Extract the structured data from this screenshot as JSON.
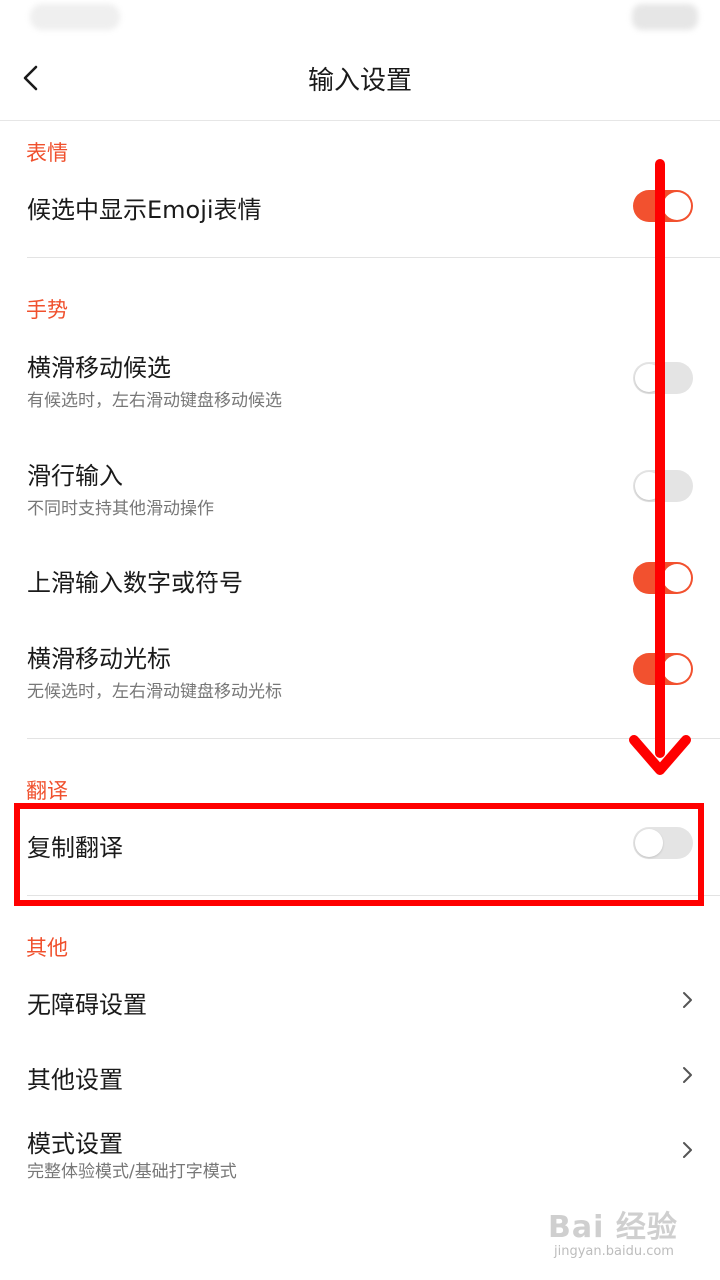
{
  "header": {
    "title": "输入设置",
    "back_icon": "chevron-left-icon"
  },
  "sections": {
    "emoji": {
      "title": "表情",
      "items": [
        {
          "title": "候选中显示Emoji表情",
          "toggle": "on"
        }
      ]
    },
    "gesture": {
      "title": "手势",
      "items": [
        {
          "title": "横滑移动候选",
          "subtitle": "有候选时，左右滑动键盘移动候选",
          "toggle": "off"
        },
        {
          "title": "滑行输入",
          "subtitle": "不同时支持其他滑动操作",
          "toggle": "off"
        },
        {
          "title": "上滑输入数字或符号",
          "toggle": "on"
        },
        {
          "title": "横滑移动光标",
          "subtitle": "无候选时，左右滑动键盘移动光标",
          "toggle": "on"
        }
      ]
    },
    "translate": {
      "title": "翻译",
      "items": [
        {
          "title": "复制翻译",
          "toggle": "off"
        }
      ]
    },
    "other": {
      "title": "其他",
      "items": [
        {
          "title": "无障碍设置",
          "icon": "chevron-right-icon"
        },
        {
          "title": "其他设置",
          "icon": "chevron-right-icon"
        },
        {
          "title": "模式设置",
          "subtitle": "完整体验模式/基础打字模式",
          "icon": "chevron-right-icon"
        }
      ]
    }
  },
  "annotations": {
    "highlight_color": "#ff0000",
    "arrow_color": "#ff0000"
  },
  "colors": {
    "accent": "#f2512f",
    "section_title": "#f0502d",
    "toggle_off": "#e4e4e4"
  },
  "watermark": {
    "logo": "Bai 经验",
    "url": "jingyan.baidu.com"
  }
}
